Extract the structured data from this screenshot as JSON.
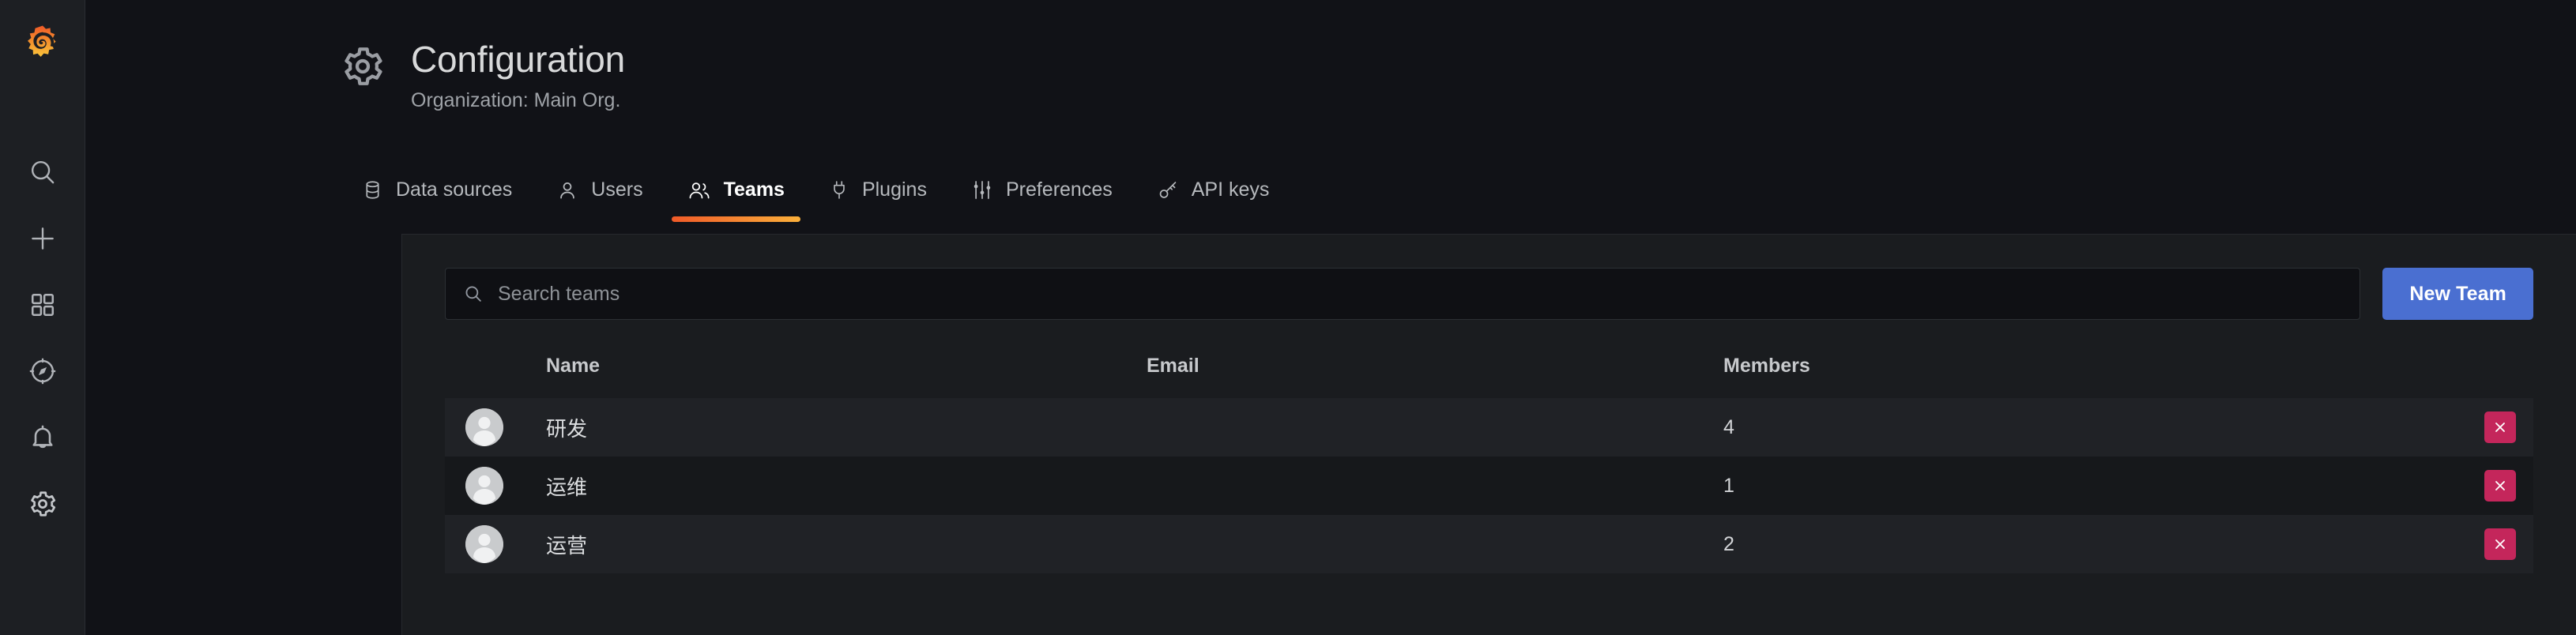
{
  "app": {
    "brand": "grafana-logo",
    "accent_orange": "#f05a28",
    "accent_blue": "#4a6fd1",
    "accent_danger": "#c4265b"
  },
  "sidebar": {
    "items": [
      {
        "icon": "search-icon",
        "name": "search"
      },
      {
        "icon": "plus-icon",
        "name": "create"
      },
      {
        "icon": "dashboards-icon",
        "name": "dashboards"
      },
      {
        "icon": "compass-icon",
        "name": "explore"
      },
      {
        "icon": "bell-icon",
        "name": "alerting"
      },
      {
        "icon": "gear-icon",
        "name": "configuration"
      }
    ]
  },
  "header": {
    "icon": "gear-icon",
    "title": "Configuration",
    "subtitle": "Organization: Main Org."
  },
  "tabs": [
    {
      "label": "Data sources",
      "icon": "database-icon",
      "active": false
    },
    {
      "label": "Users",
      "icon": "user-icon",
      "active": false
    },
    {
      "label": "Teams",
      "icon": "users-icon",
      "active": true
    },
    {
      "label": "Plugins",
      "icon": "plug-icon",
      "active": false
    },
    {
      "label": "Preferences",
      "icon": "sliders-icon",
      "active": false
    },
    {
      "label": "API keys",
      "icon": "key-icon",
      "active": false
    }
  ],
  "search": {
    "placeholder": "Search teams",
    "value": "",
    "icon": "search-icon"
  },
  "actions": {
    "new_team_label": "New Team"
  },
  "table": {
    "columns": [
      "Name",
      "Email",
      "Members"
    ],
    "rows": [
      {
        "avatar": "user-avatar",
        "name": "研发",
        "email": "",
        "members": "4",
        "delete_icon": "close-icon"
      },
      {
        "avatar": "user-avatar",
        "name": "运维",
        "email": "",
        "members": "1",
        "delete_icon": "close-icon"
      },
      {
        "avatar": "user-avatar",
        "name": "运营",
        "email": "",
        "members": "2",
        "delete_icon": "close-icon"
      }
    ]
  }
}
